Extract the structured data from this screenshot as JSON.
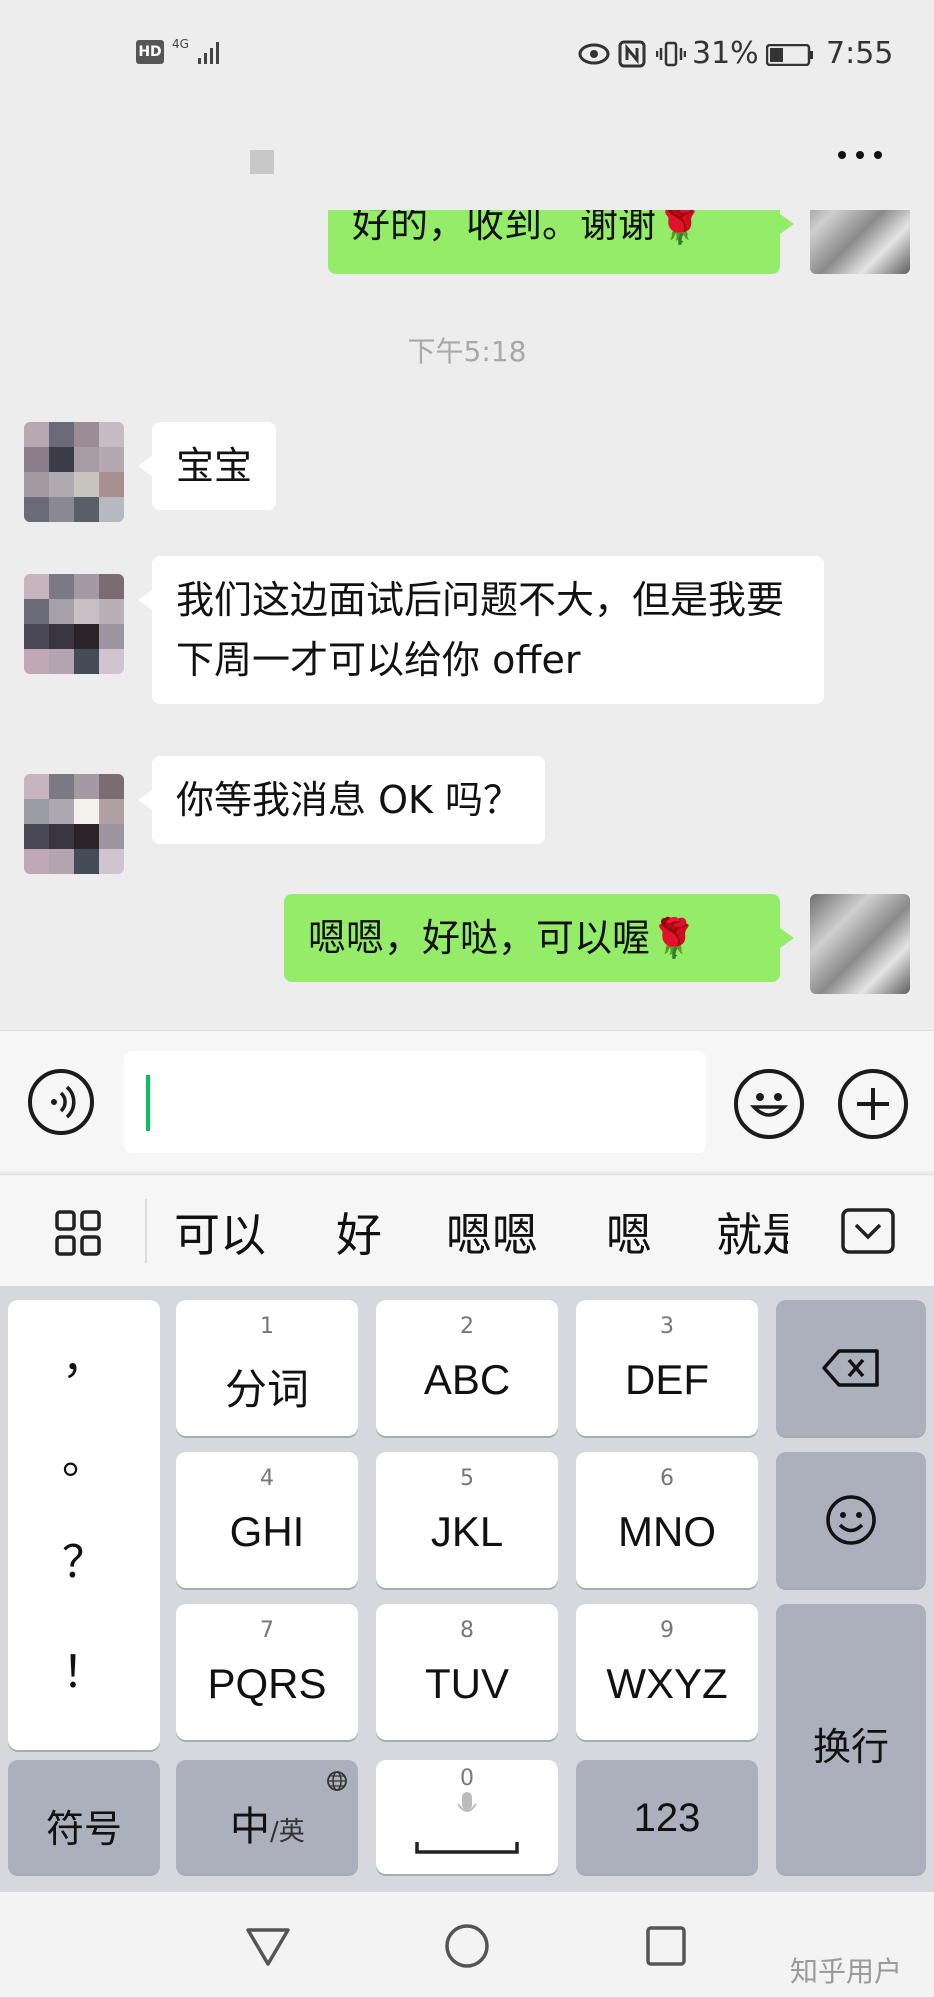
{
  "status_bar": {
    "hd": "HD",
    "network": "4G",
    "battery_percent": "31%",
    "time": "7:55",
    "icons": [
      "signal-icon",
      "eye-icon",
      "nfc-icon",
      "vibrate-icon",
      "battery-icon"
    ]
  },
  "chat": {
    "more_icon": "more-icon",
    "messages": [
      {
        "side": "out",
        "text": "好的，收到。谢谢🌹"
      },
      {
        "type": "time",
        "text": "下午5:18"
      },
      {
        "side": "in",
        "text": "宝宝"
      },
      {
        "side": "in",
        "text": "我们这边面试后问题不大，但是我要下周一才可以给你 offer"
      },
      {
        "side": "in",
        "text": "你等我消息 OK 吗？"
      },
      {
        "side": "out",
        "text": "嗯嗯，好哒，可以喔🌹"
      }
    ]
  },
  "input_bar": {
    "voice_icon": "voice-icon",
    "emoji_icon": "emoji-icon",
    "add_icon": "plus-icon",
    "value": ""
  },
  "candidates": {
    "menu_icon": "grid-icon",
    "items": [
      "可以",
      "好",
      "嗯嗯",
      "嗯",
      "就是"
    ],
    "collapse_icon": "collapse-keyboard-icon"
  },
  "keyboard": {
    "punctuation": [
      "，",
      "。",
      "？",
      "！"
    ],
    "keys": [
      {
        "num": "1",
        "label": "分词"
      },
      {
        "num": "2",
        "label": "ABC"
      },
      {
        "num": "3",
        "label": "DEF"
      },
      {
        "num": "4",
        "label": "GHI"
      },
      {
        "num": "5",
        "label": "JKL"
      },
      {
        "num": "6",
        "label": "MNO"
      },
      {
        "num": "7",
        "label": "PQRS"
      },
      {
        "num": "8",
        "label": "TUV"
      },
      {
        "num": "9",
        "label": "WXYZ"
      }
    ],
    "backspace_icon": "backspace-icon",
    "emoji_icon": "smiley-icon",
    "newline_label": "换行",
    "symbols_label": "符号",
    "lang_label_main": "中",
    "lang_label_alt": "/英",
    "space_num": "0",
    "numeric_label": "123"
  },
  "nav": {
    "back_icon": "back-triangle-icon",
    "home_icon": "home-circle-icon",
    "recents_icon": "recents-square-icon"
  },
  "watermark": "知乎用户"
}
